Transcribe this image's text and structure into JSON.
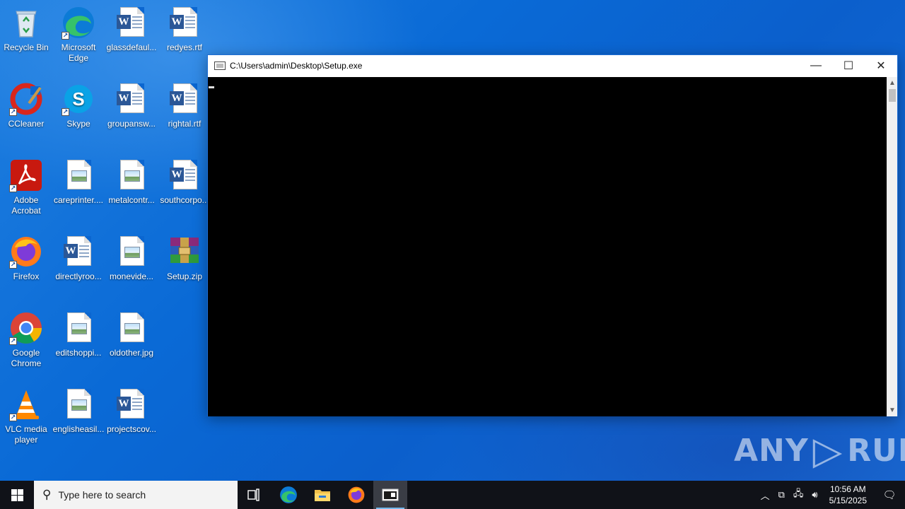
{
  "desktop": {
    "icons": [
      {
        "label": "Recycle Bin",
        "icon": "recycle-bin-icon"
      },
      {
        "label": "Microsoft Edge",
        "icon": "edge-icon"
      },
      {
        "label": "glassdefaul...",
        "icon": "word-doc-icon"
      },
      {
        "label": "redyes.rtf",
        "icon": "word-doc-icon"
      },
      {
        "label": "CCleaner",
        "icon": "ccleaner-icon"
      },
      {
        "label": "Skype",
        "icon": "skype-icon"
      },
      {
        "label": "groupansw...",
        "icon": "word-doc-icon"
      },
      {
        "label": "rightal.rtf",
        "icon": "word-doc-icon"
      },
      {
        "label": "Adobe Acrobat",
        "icon": "acrobat-icon"
      },
      {
        "label": "careprinter....",
        "icon": "image-file-icon"
      },
      {
        "label": "metalcontr...",
        "icon": "image-file-icon"
      },
      {
        "label": "southcorpo...",
        "icon": "word-doc-icon"
      },
      {
        "label": "Firefox",
        "icon": "firefox-icon"
      },
      {
        "label": "directlyroo...",
        "icon": "word-doc-icon"
      },
      {
        "label": "monevide...",
        "icon": "image-file-icon"
      },
      {
        "label": "Setup.zip",
        "icon": "winrar-archive-icon"
      },
      {
        "label": "Google Chrome",
        "icon": "chrome-icon"
      },
      {
        "label": "editshoppi...",
        "icon": "image-file-icon"
      },
      {
        "label": "oldother.jpg",
        "icon": "image-file-icon"
      },
      {
        "label": "VLC media player",
        "icon": "vlc-icon"
      },
      {
        "label": "englisheasil...",
        "icon": "image-file-icon"
      },
      {
        "label": "projectscov...",
        "icon": "word-doc-icon"
      }
    ]
  },
  "window": {
    "title": "C:\\Users\\admin\\Desktop\\Setup.exe",
    "minimize": "—",
    "maximize": "☐",
    "close": "✕"
  },
  "watermark": {
    "left": "ANY",
    "right": "RUN"
  },
  "taskbar": {
    "search_placeholder": "Type here to search",
    "clock_time": "10:56 AM",
    "clock_date": "5/15/2025"
  },
  "colors": {
    "desktop_bg": "#0b66d0",
    "taskbar_bg": "#101218",
    "console_bg": "#000000"
  }
}
